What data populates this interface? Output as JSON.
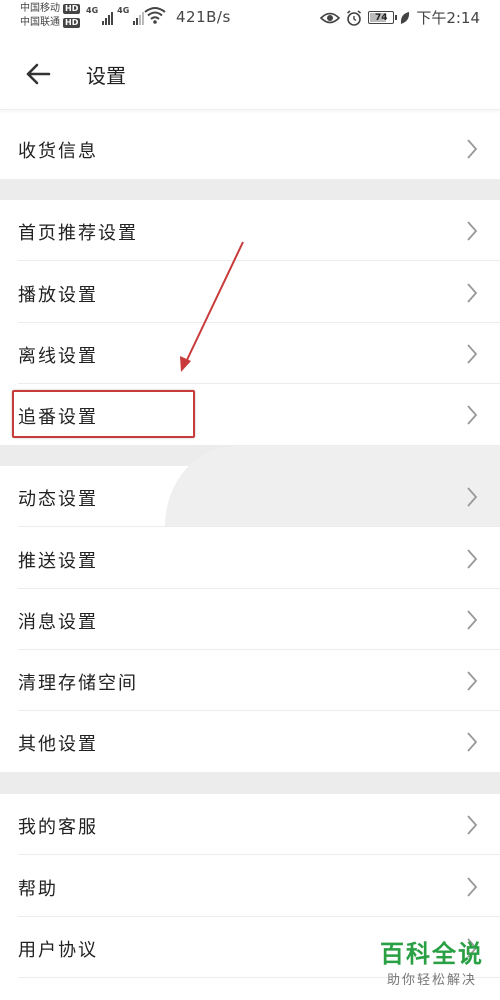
{
  "status_bar": {
    "carrier1": "中国移动",
    "carrier2": "中国联通",
    "hd_badge": "HD",
    "net_type": "4G",
    "speed": "421B/s",
    "battery_level": "74",
    "time": "下午2:14"
  },
  "header": {
    "title": "设置",
    "back_icon": "arrow-left-icon"
  },
  "sections": [
    {
      "items": [
        {
          "label": "收货信息"
        }
      ]
    },
    {
      "items": [
        {
          "label": "首页推荐设置"
        },
        {
          "label": "播放设置"
        },
        {
          "label": "离线设置"
        },
        {
          "label": "追番设置"
        }
      ]
    },
    {
      "items": [
        {
          "label": "动态设置"
        },
        {
          "label": "推送设置"
        },
        {
          "label": "消息设置"
        },
        {
          "label": "清理存储空间"
        },
        {
          "label": "其他设置"
        }
      ]
    },
    {
      "items": [
        {
          "label": "我的客服"
        },
        {
          "label": "帮助"
        },
        {
          "label": "用户协议"
        }
      ]
    }
  ],
  "annotation": {
    "highlight_color": "#c93a3a",
    "highlighted_item": "追番设置"
  },
  "watermark": {
    "title": "百科全说",
    "subtitle": "助你轻松解决",
    "color": "#2aa044"
  }
}
